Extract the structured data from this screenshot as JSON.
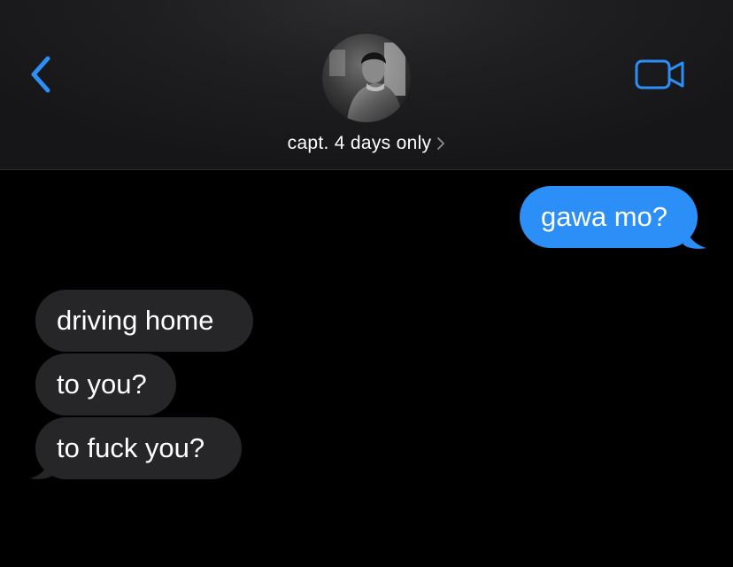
{
  "header": {
    "contact_name": "capt. 4 days only",
    "back_icon": "chevron-left-icon",
    "video_icon": "video-camera-icon",
    "accent_color": "#2c8ef7"
  },
  "messages": {
    "outgoing": [
      {
        "text": "gawa mo?"
      }
    ],
    "incoming": [
      {
        "text": "driving home"
      },
      {
        "text": "to you?"
      },
      {
        "text": "to fuck you?"
      }
    ]
  }
}
